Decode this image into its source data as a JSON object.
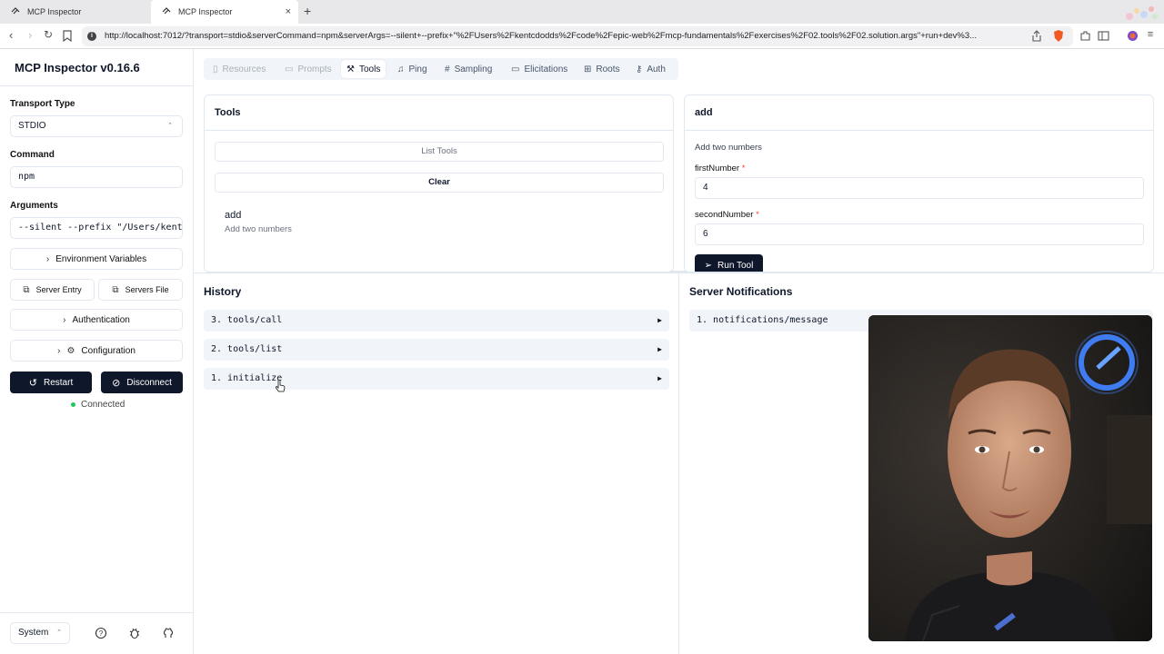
{
  "browser": {
    "tabs": [
      {
        "title": "MCP Inspector",
        "active": false
      },
      {
        "title": "MCP Inspector",
        "active": true
      }
    ],
    "new_tab_glyph": "+",
    "close_glyph": "×",
    "url": "http://localhost:7012/?transport=stdio&serverCommand=npm&serverArgs=--silent+--prefix+\"%2FUsers%2Fkentcdodds%2Fcode%2Fepic-web%2Fmcp-fundamentals%2Fexercises%2F02.tools%2F02.solution.args\"+run+dev%3..."
  },
  "sidebar": {
    "app_title": "MCP Inspector v0.16.6",
    "transport_label": "Transport Type",
    "transport_value": "STDIO",
    "command_label": "Command",
    "command_value": "npm",
    "arguments_label": "Arguments",
    "arguments_value": "--silent --prefix \"/Users/kentc",
    "env_button": "Environment Variables",
    "server_entry_button": "Server Entry",
    "servers_file_button": "Servers File",
    "auth_button": "Authentication",
    "config_button": "Configuration",
    "restart_button": "Restart",
    "disconnect_button": "Disconnect",
    "status_text": "Connected",
    "theme_value": "System"
  },
  "tabs": {
    "resources": "Resources",
    "prompts": "Prompts",
    "tools": "Tools",
    "ping": "Ping",
    "sampling": "Sampling",
    "elicitations": "Elicitations",
    "roots": "Roots",
    "auth": "Auth"
  },
  "tools_panel": {
    "title": "Tools",
    "list_button": "List Tools",
    "clear_button": "Clear",
    "items": [
      {
        "name": "add",
        "description": "Add two numbers"
      }
    ]
  },
  "tool_detail": {
    "title": "add",
    "description": "Add two numbers",
    "fields": [
      {
        "label": "firstNumber",
        "required_mark": "*",
        "value": "4"
      },
      {
        "label": "secondNumber",
        "required_mark": "*",
        "value": "6"
      }
    ],
    "run_button": "Run Tool"
  },
  "history": {
    "title": "History",
    "items": [
      {
        "text": "3. tools/call"
      },
      {
        "text": "2. tools/list"
      },
      {
        "text": "1. initialize"
      }
    ],
    "expand_glyph": "▶"
  },
  "notifications": {
    "title": "Server Notifications",
    "items": [
      {
        "text": "1. notifications/message"
      }
    ]
  },
  "colors": {
    "primary_button": "#0f172a",
    "connected_dot": "#22c55e",
    "required_mark": "#ef4444"
  }
}
